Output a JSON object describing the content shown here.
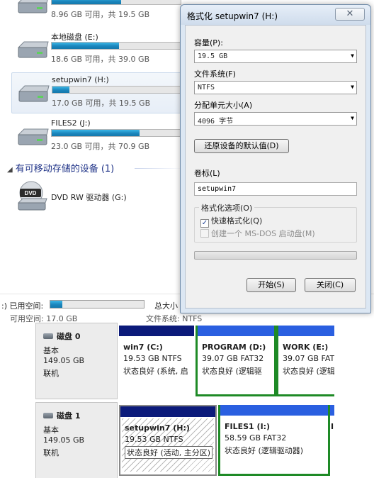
{
  "explorer": {
    "drives": [
      {
        "name": "",
        "info": "8.96 GB 可用，共 19.5 GB",
        "used_fraction": 0.54,
        "selected": false
      },
      {
        "name": "本地磁盘 (E:)",
        "info": "18.6 GB 可用，共 39.0 GB",
        "used_fraction": 0.52,
        "selected": false
      },
      {
        "name": "setupwin7 (H:)",
        "info": "17.0 GB 可用，共 19.5 GB",
        "used_fraction": 0.13,
        "selected": true
      },
      {
        "name": "FILES2 (J:)",
        "info": "23.0 GB 可用，共 70.9 GB",
        "used_fraction": 0.68,
        "selected": false
      }
    ],
    "removable_header": "有可移动存储的设备 (1)",
    "dvd": {
      "name": "DVD RW 驱动器 (G:)",
      "badge": "DVD"
    },
    "statusbar": {
      "used_label": ":) 已用空间:",
      "used_fraction": 0.13,
      "total_label": "总大小",
      "free_label": "可用空间: 17.0 GB",
      "fs_label": "文件系统: NTFS"
    }
  },
  "format_dialog": {
    "title": "格式化 setupwin7 (H:)",
    "close_glyph": "✕",
    "capacity_label": "容量(P):",
    "capacity_value": "19.5 GB",
    "filesystem_label": "文件系统(F)",
    "filesystem_value": "NTFS",
    "allocation_label": "分配单元大小(A)",
    "allocation_value": "4096 字节",
    "restore_defaults": "还原设备的默认值(D)",
    "volume_label": "卷标(L)",
    "volume_value": "setupwin7",
    "options_title": "格式化选项(O)",
    "quick_format": "快速格式化(Q)",
    "quick_format_checked": true,
    "msdos_disk": "创建一个 MS-DOS 启动盘(M)",
    "msdos_checked": false,
    "progress": 0,
    "start_button": "开始(S)",
    "close_button": "关闭(C)"
  },
  "disk_management": {
    "disks": [
      {
        "title": "磁盘 0",
        "type": "基本",
        "size": "149.05 GB",
        "state": "联机",
        "partitions": [
          {
            "name": "win7  (C:)",
            "size": "19.53 GB NTFS",
            "status": "状态良好 (系统, 启"
          },
          {
            "name": "PROGRAM  (D:)",
            "size": "39.07 GB FAT32",
            "status": "状态良好 (逻辑驱"
          },
          {
            "name": "WORK  (E:)",
            "size": "39.07 GB FAT",
            "status": "状态良好 (逻辑"
          }
        ]
      },
      {
        "title": "磁盘 1",
        "type": "基本",
        "size": "149.05 GB",
        "state": "联机",
        "partitions": [
          {
            "name": "setupwin7  (H:)",
            "size": "19.53 GB NTFS",
            "status": "状态良好 (活动, 主分区)"
          },
          {
            "name": "FILES1  (I:)",
            "size": "58.59 GB FAT32",
            "status": "状态良好 (逻辑驱动器)"
          },
          {
            "name": "I",
            "size": "",
            "status": ""
          }
        ]
      }
    ]
  }
}
